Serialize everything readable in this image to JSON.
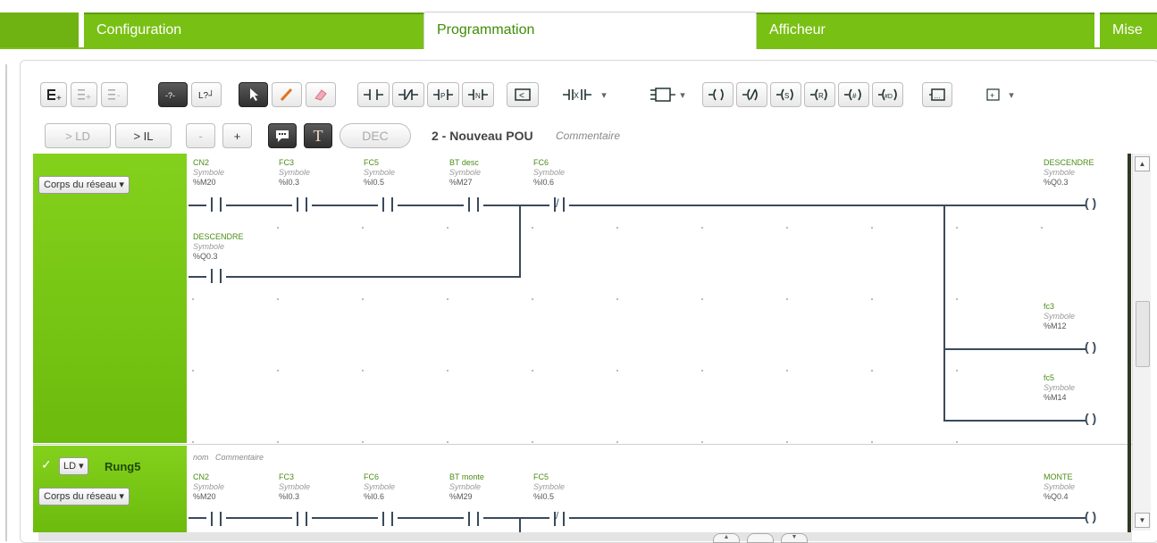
{
  "tabs": [
    {
      "label": "Configuration",
      "active": false
    },
    {
      "label": "Programmation",
      "active": true
    },
    {
      "label": "Afficheur",
      "active": false
    },
    {
      "label": "Mise",
      "active": false
    }
  ],
  "toolbar": {
    "row2": {
      "to_ld": "> LD",
      "to_il": "> IL",
      "minus": "-",
      "plus": "+",
      "dec": "DEC",
      "t_label": "T"
    },
    "pou_title": "2 - Nouveau POU",
    "pou_comment": "Commentaire"
  },
  "rung4": {
    "corps_label": "Corps du réseau",
    "row1": [
      {
        "name": "CN2",
        "symbol": "Symbole",
        "addr": "%M20",
        "type": "NO"
      },
      {
        "name": "FC3",
        "symbol": "Symbole",
        "addr": "%I0.3",
        "type": "NO"
      },
      {
        "name": "FC5",
        "symbol": "Symbole",
        "addr": "%I0.5",
        "type": "NO"
      },
      {
        "name": "BT desc",
        "symbol": "Symbole",
        "addr": "%M27",
        "type": "NO"
      },
      {
        "name": "FC6",
        "symbol": "Symbole",
        "addr": "%I0.6",
        "type": "NC"
      }
    ],
    "branch": {
      "name": "DESCENDRE",
      "symbol": "Symbole",
      "addr": "%Q0.3"
    },
    "coils": [
      {
        "name": "DESCENDRE",
        "symbol": "Symbole",
        "addr": "%Q0.3"
      },
      {
        "name": "fc3",
        "symbol": "Symbole",
        "addr": "%M12"
      },
      {
        "name": "fc5",
        "symbol": "Symbole",
        "addr": "%M14"
      }
    ]
  },
  "rung5": {
    "ld_label": "LD",
    "name": "Rung5",
    "corps_label": "Corps du réseau",
    "header_name": "nom",
    "header_comment": "Commentaire",
    "row1": [
      {
        "name": "CN2",
        "symbol": "Symbole",
        "addr": "%M20"
      },
      {
        "name": "FC3",
        "symbol": "Symbole",
        "addr": "%I0.3"
      },
      {
        "name": "FC6",
        "symbol": "Symbole",
        "addr": "%I0.6"
      },
      {
        "name": "BT monte",
        "symbol": "Symbole",
        "addr": "%M29"
      },
      {
        "name": "FC5",
        "symbol": "Symbole",
        "addr": "%I0.5"
      }
    ],
    "coil": {
      "name": "MONTE",
      "symbol": "Symbole",
      "addr": "%Q0.4"
    }
  },
  "colors": {
    "green": "#79c014",
    "rung_green": "#6cbb0d",
    "wire": "#3a4a5a"
  }
}
